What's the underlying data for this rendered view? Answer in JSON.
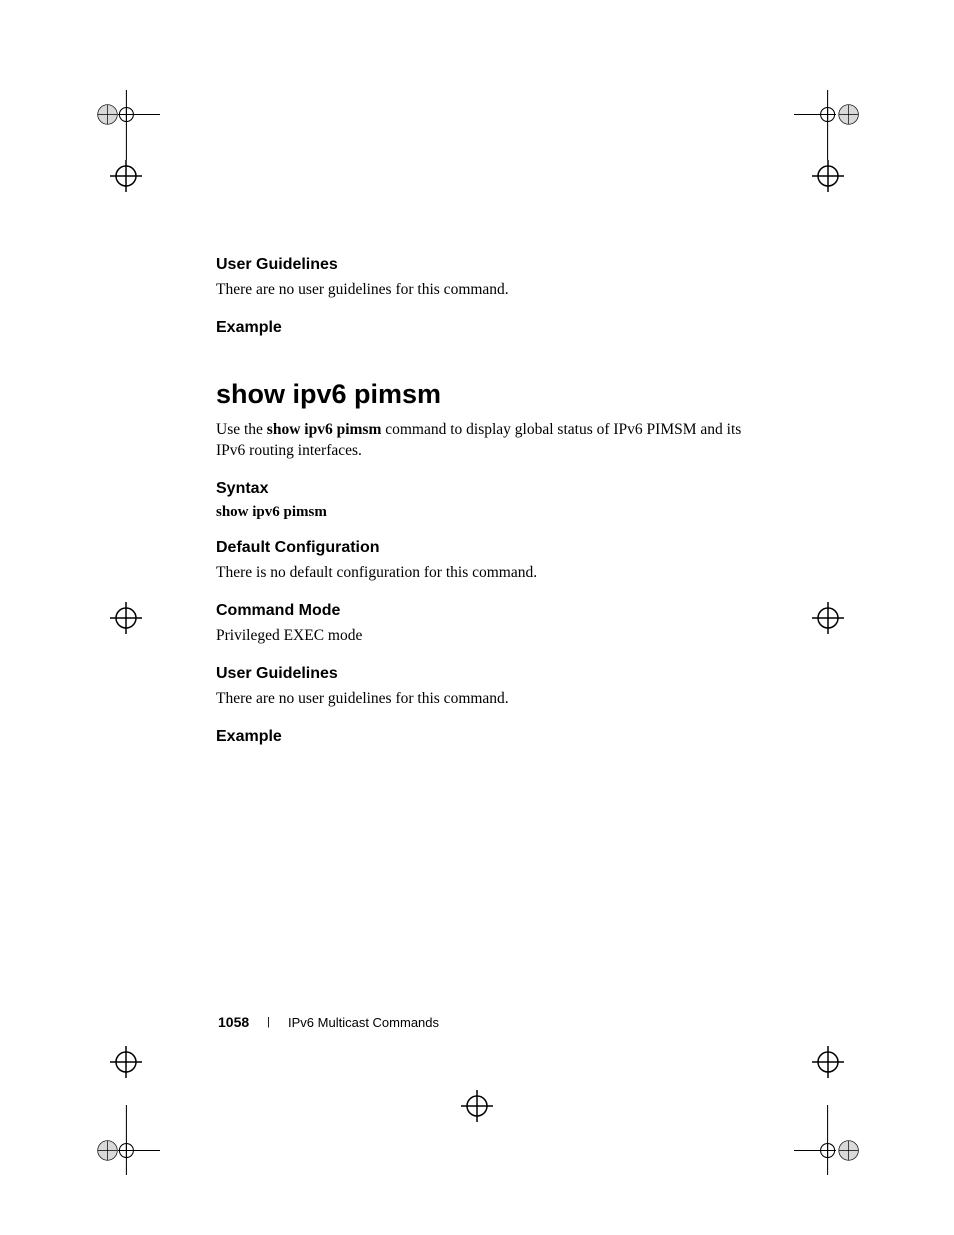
{
  "sections": {
    "user_guidelines_1": {
      "heading": "User Guidelines",
      "body": "There are no user guidelines for this command."
    },
    "example_1": {
      "heading": "Example"
    },
    "command_title": "show ipv6 pimsm",
    "command_intro_prefix": "Use the ",
    "command_intro_bold": "show ipv6 pimsm",
    "command_intro_suffix": " command to display global status of IPv6 PIMSM and its IPv6 routing interfaces.",
    "syntax": {
      "heading": "Syntax",
      "value": "show ipv6 pimsm"
    },
    "default_config": {
      "heading": "Default Configuration",
      "body": "There is no default configuration for this command."
    },
    "command_mode": {
      "heading": "Command Mode",
      "body": "Privileged EXEC mode"
    },
    "user_guidelines_2": {
      "heading": "User Guidelines",
      "body": "There are no user guidelines for this command."
    },
    "example_2": {
      "heading": "Example"
    }
  },
  "footer": {
    "page_number": "1058",
    "chapter": "IPv6 Multicast Commands"
  }
}
